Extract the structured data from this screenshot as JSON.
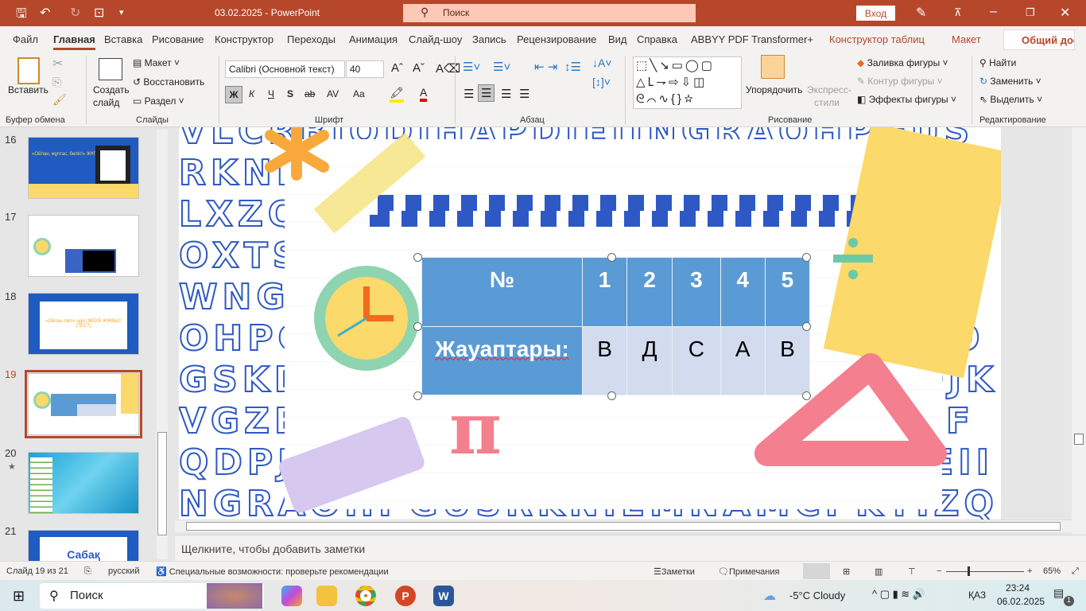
{
  "titlebar": {
    "title": "03.02.2025  -  PowerPoint",
    "search_placeholder": "Поиск",
    "login": "Вход"
  },
  "tabs": [
    "Файл",
    "Главная",
    "Вставка",
    "Рисование",
    "Конструктор",
    "Переходы",
    "Анимация",
    "Слайд-шоу",
    "Запись",
    "Рецензирование",
    "Вид",
    "Справка",
    "ABBYY PDF Transformer+",
    "Конструктор таблиц",
    "Макет"
  ],
  "active_tab": "Главная",
  "share_label": "Общий доступ",
  "ribbon": {
    "clipboard": {
      "paste": "Вставить",
      "group": "Буфер обмена"
    },
    "slides": {
      "new_slide_1": "Создать",
      "new_slide_2": "слайд",
      "layout": "Макет",
      "reset": "Восстановить",
      "section": "Раздел",
      "group": "Слайды"
    },
    "font": {
      "name": "Calibri (Основной текст)",
      "size": "40",
      "bold": "Ж",
      "italic": "К",
      "underline": "Ч",
      "shadow": "S",
      "strike": "ab",
      "spacing": "AV",
      "case": "Aa",
      "group": "Шрифт"
    },
    "paragraph": {
      "group": "Абзац"
    },
    "drawing": {
      "arrange": "Упорядочить",
      "quick_styles_1": "Экспресс-",
      "quick_styles_2": "стили",
      "fill": "Заливка фигуры",
      "outline": "Контур фигуры",
      "effects": "Эффекты фигуры",
      "group": "Рисование"
    },
    "editing": {
      "find": "Найти",
      "replace": "Заменить",
      "select": "Выделить",
      "group": "Редактирование"
    }
  },
  "thumbnails": [
    {
      "num": "16",
      "text": "«Ойлан, жұптас, бөліс!» ЖҰПТЫҚ ЖҰМЫС"
    },
    {
      "num": "17"
    },
    {
      "num": "18",
      "text": "«Ойлан тап!» әдісі ЖЕКЕ ЖҰМЫС (ТЕСТ)"
    },
    {
      "num": "19",
      "selected": true
    },
    {
      "num": "20",
      "star": "★"
    },
    {
      "num": "21",
      "text": "Сабақ"
    }
  ],
  "slide": {
    "table": {
      "header": [
        "№",
        "1",
        "2",
        "3",
        "4",
        "5"
      ],
      "row": [
        "Жауаптары:",
        "В",
        "Д",
        "С",
        "А",
        "В"
      ]
    },
    "colors": {
      "header": "#5b9bd5",
      "cells": "#d2dcee",
      "letters": "#2e58c4"
    },
    "background_letters": "VLCRBIQDJHAPDJEIINGRAOHPGUSRKNIEMNAMCPKTIZQLVTOGSKDFCLXZQBIEICHWBIYWDEQOJKVGZEQOXTSBMVIDGWEQORSTVDFQDPJUWNGLZE"
  },
  "notes_placeholder": "Щелкните, чтобы добавить заметки",
  "status": {
    "slide": "Слайд 19 из 21",
    "language": "русский",
    "accessibility": "Специальные возможности: проверьте рекомендации",
    "notes": "Заметки",
    "comments": "Примечания",
    "zoom": "65%",
    "zoom_value": 65
  },
  "taskbar": {
    "search": "Поиск",
    "weather": "-5°C  Cloudy",
    "lang": "ҚАЗ",
    "time": "23:24",
    "date": "06.02.2025",
    "notif": "1"
  }
}
